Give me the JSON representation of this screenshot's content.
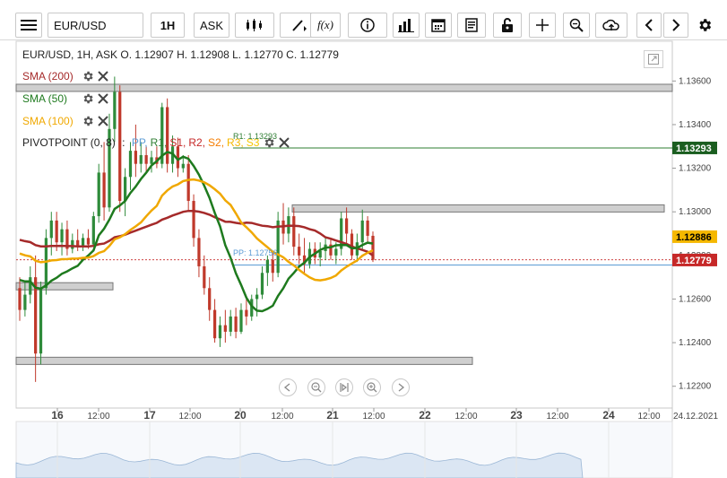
{
  "toolbar": {
    "symbol": "EUR/USD",
    "interval": "1H",
    "price_type": "ASK",
    "icons": [
      "menu-icon",
      "candlestick-icon",
      "draw-icon",
      "function-icon",
      "info-icon",
      "volume-bars-icon",
      "calendar-icon",
      "report-icon",
      "lock-icon",
      "crosshair-icon",
      "zoom-icon",
      "cloud-upload-icon",
      "prev-icon",
      "next-icon",
      "settings-icon"
    ]
  },
  "header": {
    "ohlc": "EUR/USD, 1H, ASK   O. 1.12907 H. 1.12908 L. 1.12770 C. 1.12779"
  },
  "indicators": [
    {
      "label": "SMA (200)",
      "color": "#a52a2a"
    },
    {
      "label": "SMA (50)",
      "color": "#1e7a1e"
    },
    {
      "label": "SMA (100)",
      "color": "#f0a800"
    }
  ],
  "pivot": {
    "prefix": "PIVOTPOINT (0, 8)",
    "sep": " : ",
    "items": [
      {
        "label": "PP,",
        "color": "#5b9bd5"
      },
      {
        "label": "R1,",
        "color": "#2e7d32"
      },
      {
        "label": "S1,",
        "color": "#c62828"
      },
      {
        "label": "R2,",
        "color": "#c62828"
      },
      {
        "label": "S2,",
        "color": "#f57c00"
      },
      {
        "label": "R3,",
        "color": "#f5b800"
      },
      {
        "label": "S3",
        "color": "#f5c800"
      }
    ],
    "r1_label": "R1: 1.13293",
    "pp_label": "PP: 1.12756"
  },
  "price_axis": {
    "ticks": [
      "1.13600",
      "1.13400",
      "1.13200",
      "1.13000",
      "1.12800",
      "1.12600",
      "1.12400",
      "1.12200"
    ],
    "badges": [
      {
        "value": "1.13293",
        "bg": "#1b5e20",
        "fg": "#ffffff"
      },
      {
        "value": "1.12886",
        "bg": "#f5b800",
        "fg": "#000000"
      },
      {
        "value": "1.12779",
        "bg": "#c62828",
        "fg": "#ffffff"
      }
    ]
  },
  "time_axis": {
    "labels": [
      {
        "text": "16",
        "bold": true
      },
      {
        "text": "12:00",
        "bold": false
      },
      {
        "text": "17",
        "bold": true
      },
      {
        "text": "12:00",
        "bold": false
      },
      {
        "text": "20",
        "bold": true
      },
      {
        "text": "12:00",
        "bold": false
      },
      {
        "text": "21",
        "bold": true
      },
      {
        "text": "12:00",
        "bold": false
      },
      {
        "text": "22",
        "bold": true
      },
      {
        "text": "12:00",
        "bold": false
      },
      {
        "text": "23",
        "bold": true
      },
      {
        "text": "12:00",
        "bold": false
      },
      {
        "text": "24",
        "bold": true
      },
      {
        "text": "12:00",
        "bold": false
      },
      {
        "text": "24.12.2021",
        "bold": false
      }
    ]
  },
  "chart_data": {
    "type": "candlestick",
    "ylim": [
      1.121,
      1.137
    ],
    "series_candles": [
      [
        1.1265,
        1.127,
        1.125,
        1.1255
      ],
      [
        1.1255,
        1.1268,
        1.1252,
        1.1262
      ],
      [
        1.1262,
        1.1275,
        1.1258,
        1.127
      ],
      [
        1.127,
        1.128,
        1.1222,
        1.1235
      ],
      [
        1.1235,
        1.1268,
        1.123,
        1.1265
      ],
      [
        1.1265,
        1.1292,
        1.1262,
        1.1288
      ],
      [
        1.1288,
        1.13,
        1.128,
        1.1296
      ],
      [
        1.1296,
        1.13,
        1.1282,
        1.1286
      ],
      [
        1.1286,
        1.1295,
        1.128,
        1.1292
      ],
      [
        1.1292,
        1.1296,
        1.128,
        1.1283
      ],
      [
        1.1283,
        1.129,
        1.1281,
        1.1287
      ],
      [
        1.1287,
        1.1292,
        1.1282,
        1.1284
      ],
      [
        1.1284,
        1.129,
        1.1282,
        1.1288
      ],
      [
        1.1288,
        1.1292,
        1.1283,
        1.1285
      ],
      [
        1.1285,
        1.13,
        1.1284,
        1.1298
      ],
      [
        1.1298,
        1.1322,
        1.1295,
        1.1318
      ],
      [
        1.1318,
        1.1332,
        1.1296,
        1.1302
      ],
      [
        1.1302,
        1.1345,
        1.13,
        1.1338
      ],
      [
        1.1338,
        1.1362,
        1.1332,
        1.1355
      ],
      [
        1.1355,
        1.1358,
        1.13,
        1.1305
      ],
      [
        1.1305,
        1.132,
        1.1298,
        1.1316
      ],
      [
        1.1316,
        1.1332,
        1.131,
        1.1328
      ],
      [
        1.1328,
        1.134,
        1.1316,
        1.1322
      ],
      [
        1.1322,
        1.1332,
        1.1318,
        1.1326
      ],
      [
        1.1326,
        1.133,
        1.1318,
        1.1322
      ],
      [
        1.1322,
        1.1328,
        1.1318,
        1.1325
      ],
      [
        1.1325,
        1.133,
        1.132,
        1.1322
      ],
      [
        1.1322,
        1.135,
        1.132,
        1.1348
      ],
      [
        1.1348,
        1.1352,
        1.1318,
        1.1322
      ],
      [
        1.1322,
        1.1335,
        1.1318,
        1.133
      ],
      [
        1.133,
        1.1334,
        1.1316,
        1.132
      ],
      [
        1.132,
        1.1326,
        1.1318,
        1.1322
      ],
      [
        1.1322,
        1.1326,
        1.13,
        1.1305
      ],
      [
        1.1305,
        1.1308,
        1.1284,
        1.1288
      ],
      [
        1.1288,
        1.1292,
        1.127,
        1.1275
      ],
      [
        1.1275,
        1.128,
        1.1262,
        1.1265
      ],
      [
        1.1265,
        1.127,
        1.125,
        1.1255
      ],
      [
        1.1255,
        1.126,
        1.124,
        1.1242
      ],
      [
        1.1242,
        1.1252,
        1.1238,
        1.1248
      ],
      [
        1.1248,
        1.1255,
        1.124,
        1.1245
      ],
      [
        1.1245,
        1.1255,
        1.1243,
        1.1252
      ],
      [
        1.1252,
        1.1256,
        1.1242,
        1.1245
      ],
      [
        1.1245,
        1.1258,
        1.1244,
        1.1255
      ],
      [
        1.1255,
        1.126,
        1.1248,
        1.1252
      ],
      [
        1.1252,
        1.1262,
        1.125,
        1.126
      ],
      [
        1.126,
        1.1265,
        1.1252,
        1.1262
      ],
      [
        1.1262,
        1.1275,
        1.126,
        1.1272
      ],
      [
        1.1272,
        1.128,
        1.1266,
        1.1278
      ],
      [
        1.1278,
        1.1282,
        1.1268,
        1.1272
      ],
      [
        1.1272,
        1.13,
        1.127,
        1.1296
      ],
      [
        1.1296,
        1.1304,
        1.1285,
        1.129
      ],
      [
        1.129,
        1.1302,
        1.1286,
        1.1298
      ],
      [
        1.1298,
        1.1302,
        1.128,
        1.1284
      ],
      [
        1.1284,
        1.129,
        1.1276,
        1.128
      ],
      [
        1.128,
        1.1288,
        1.1272,
        1.1276
      ],
      [
        1.1276,
        1.1286,
        1.1274,
        1.1283
      ],
      [
        1.1283,
        1.1286,
        1.1276,
        1.1279
      ],
      [
        1.1279,
        1.1286,
        1.1275,
        1.1282
      ],
      [
        1.1282,
        1.1288,
        1.1278,
        1.1285
      ],
      [
        1.1285,
        1.1288,
        1.1278,
        1.128
      ],
      [
        1.128,
        1.1286,
        1.1276,
        1.1283
      ],
      [
        1.1283,
        1.13,
        1.128,
        1.1297
      ],
      [
        1.1297,
        1.1302,
        1.1285,
        1.129
      ],
      [
        1.129,
        1.1292,
        1.1278,
        1.128
      ],
      [
        1.128,
        1.129,
        1.1277,
        1.1286
      ],
      [
        1.1286,
        1.1301,
        1.1282,
        1.1296
      ],
      [
        1.1296,
        1.1298,
        1.1286,
        1.1289
      ],
      [
        1.1289,
        1.1291,
        1.1277,
        1.1278
      ]
    ],
    "zones": [
      {
        "from": 1.13585,
        "to": 1.13565
      },
      {
        "from": 1.13032,
        "to": 1.13012
      },
      {
        "from": 1.12675,
        "to": 1.12645
      },
      {
        "from": 1.12333,
        "to": 1.123
      }
    ]
  }
}
